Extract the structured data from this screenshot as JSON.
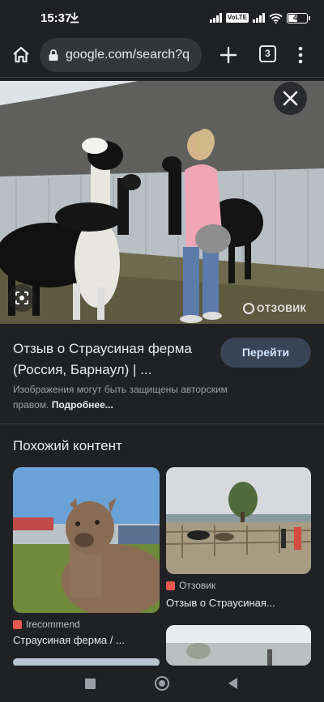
{
  "status_bar": {
    "time": "15:37",
    "network_badge": "VoLTE",
    "battery": "49",
    "icons": [
      "download-icon",
      "signal-icon",
      "wifi-icon",
      "battery-icon"
    ]
  },
  "toolbar": {
    "url": "google.com/search?q",
    "tab_count": "3",
    "icons": [
      "home-icon",
      "lock-icon",
      "plus-icon",
      "more-vert-icon"
    ]
  },
  "image_viewer": {
    "watermark": "ОТЗОВИК",
    "icons": [
      "close-icon",
      "lens-icon"
    ]
  },
  "result": {
    "title": "Отзыв о Страусиная ферма (Россия, Барнаул) | ...",
    "visit_button": "Перейти",
    "copyright_text": "Изображения могут быть защищены авторским правом.",
    "more_link": "Подробнее..."
  },
  "related": {
    "heading": "Похожий контент",
    "cards": [
      {
        "source": "Irecommend",
        "title": "Страусиная ферма / ...",
        "source_color": "#e8584f"
      },
      {
        "source": "Отзовик",
        "title": "Отзыв о Страусиная...",
        "source_color": "#e8584f"
      }
    ]
  },
  "nav_bar": {
    "icons": [
      "recents-icon",
      "home-circle-icon",
      "back-icon"
    ]
  },
  "colors": {
    "background": "#202124",
    "button_bg": "#394457",
    "button_text": "#d2e3fc"
  }
}
